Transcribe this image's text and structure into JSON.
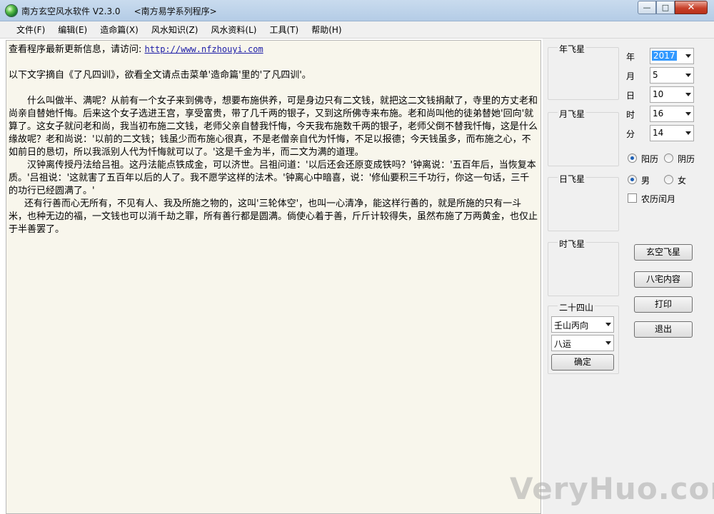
{
  "window": {
    "title": "南方玄空风水软件 V2.3.0     <南方易学系列程序>",
    "minimize": "—",
    "maximize": "□",
    "close": "✕"
  },
  "menu": [
    "文件(F)",
    "编辑(E)",
    "造命篇(X)",
    "风水知识(Z)",
    "风水资料(L)",
    "工具(T)",
    "帮助(H)"
  ],
  "content": {
    "update_prefix": "查看程序最新更新信息，请访问: ",
    "update_url": "http://www.nfzhouyi.com",
    "intro": "以下文字摘自《了凡四训》，欲看全文请点击菜单'造命篇'里的'了凡四训'。",
    "para1": "什么叫做半、满呢？从前有一个女子来到佛寺，想要布施供养，可是身边只有二文钱，就把这二文钱捐献了，寺里的方丈老和尚亲自替她忏悔。后来这个女子选进王宫，享受富贵，带了几千两的银子，又到这所佛寺来布施。老和尚叫他的徒弟替她'回向'就算了。这女子就问老和尚，我当初布施二文钱，老师父亲自替我忏悔，今天我布施数千两的银子，老师父倒不替我忏悔，这是什么缘故呢？老和尚说：'以前的二文钱；钱虽少而布施心很真，不是老僧亲自代为忏悔，不足以报德；今天钱虽多，而布施之心，不如前日的恳切，所以我派别人代为忏悔就可以了。'这是千金为半，而二文为满的道理。",
    "para2": "汉钟离传授丹法给吕祖。这丹法能点铁成金，可以济世。吕祖问道：'以后还会还原变成铁吗？'钟离说：'五百年后，当恢复本质。'吕祖说：'这就害了五百年以后的人了。我不愿学这样的法术。'钟离心中暗喜，说：'修仙要积三千功行，你这一句话，三千的功行已经圆满了。'",
    "para3": "还有行善而心无所有，不见有人、我及所施之物的，这叫'三轮体空'，也叫一心清净，能这样行善的，就是所施的只有一斗米，也种无边的福，一文钱也可以消千劫之罪，所有善行都是圆满。倘使心着于善，斤斤计较得失，虽然布施了万两黄金，也仅止于半善罢了。"
  },
  "panel": {
    "groups": {
      "year_star": "年飞星",
      "month_star": "月飞星",
      "day_star": "日飞星",
      "hour_star": "时飞星",
      "mountains": "二十四山"
    },
    "fields": {
      "year_label": "年",
      "year_value": "2017",
      "month_label": "月",
      "month_value": "5",
      "day_label": "日",
      "day_value": "10",
      "hour_label": "时",
      "hour_value": "16",
      "minute_label": "分",
      "minute_value": "14"
    },
    "calendar": {
      "solar": "阳历",
      "lunar": "阴历",
      "selected": "solar"
    },
    "gender": {
      "male": "男",
      "female": "女",
      "selected": "male"
    },
    "leap_month": {
      "label": "农历闰月",
      "checked": false
    },
    "buttons": {
      "xuankong": "玄空飞星",
      "bazhai": "八宅内容",
      "print": "打印",
      "exit": "退出",
      "confirm": "确定"
    },
    "mountain_value": "壬山丙向",
    "period_value": "八运"
  },
  "watermark": "VeryHuo.com"
}
